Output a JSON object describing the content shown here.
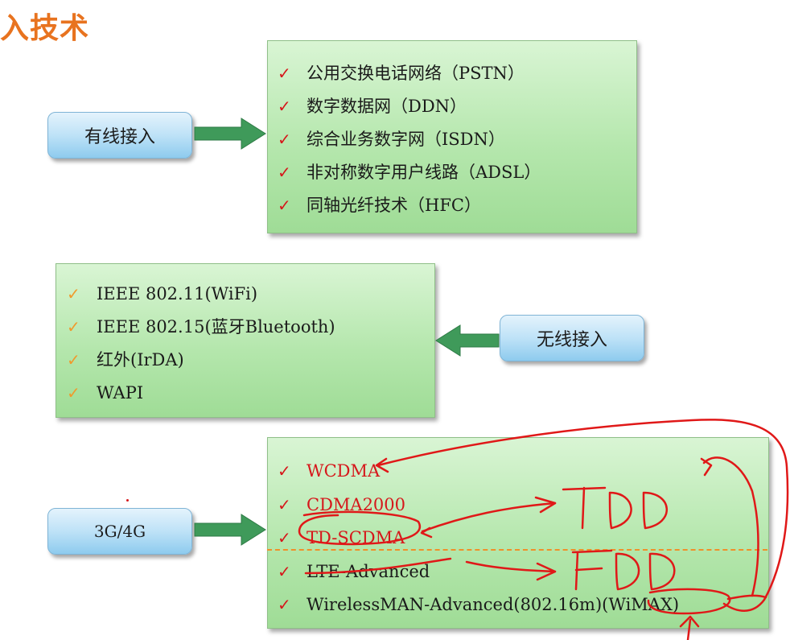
{
  "title": "入技术",
  "wired": {
    "label": "有线接入",
    "items": [
      "公用交换电话网络（PSTN）",
      "数字数据网（DDN）",
      "综合业务数字网（ISDN）",
      "非对称数字用户线路（ADSL）",
      "同轴光纤技术（HFC）"
    ]
  },
  "wireless": {
    "label": "无线接入",
    "items": [
      "IEEE 802.11(WiFi)",
      "IEEE 802.15(蓝牙Bluetooth)",
      "红外(IrDA)",
      "WAPI"
    ]
  },
  "cellular": {
    "label": "3G/4G",
    "items": [
      "WCDMA",
      "CDMA2000",
      "TD-SCDMA",
      "LTE-Advanced",
      "WirelessMAN-Advanced(802.16m)(WiMAX)"
    ]
  },
  "check_mark": "✓",
  "colors": {
    "title": "#e8731f",
    "panel_green": "#b5e7ad",
    "pill_blue": "#bee2f7",
    "arrow_green": "#3f9a5a",
    "check_red": "#d6171b",
    "check_orange": "#f09a2c",
    "annotation_red": "#e01818"
  }
}
